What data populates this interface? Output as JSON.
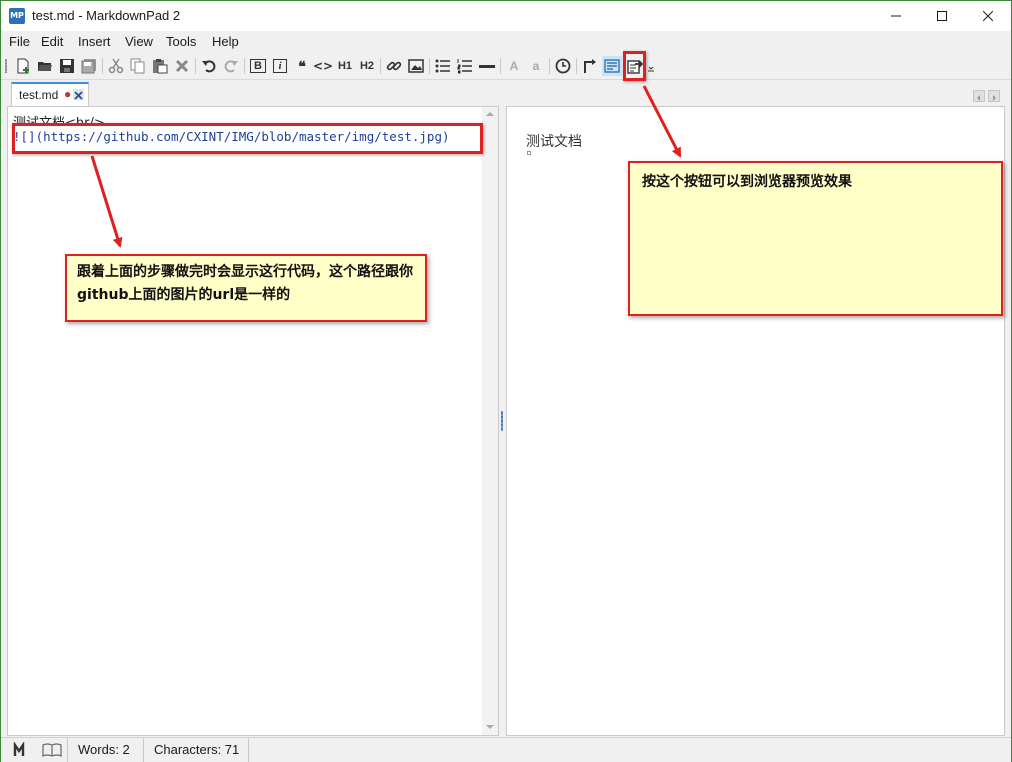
{
  "window": {
    "title": "test.md - MarkdownPad 2",
    "app_icon_text": "MP",
    "minimize_glyph": "—",
    "maximize_glyph": "☐",
    "close_glyph": "✕"
  },
  "menu": {
    "items": [
      "File",
      "Edit",
      "Insert",
      "View",
      "Tools",
      "Help"
    ]
  },
  "toolbar": {
    "h1_label": "H1",
    "h2_label": "H2",
    "bold_label": "B",
    "italic_label": "i",
    "quote_label": "❝",
    "code_label": "<>",
    "upper_a_label": "A",
    "lower_a_label": "a"
  },
  "tabs": {
    "active_label": "test.md",
    "modified_marker": "●",
    "close_glyph": "✕"
  },
  "editor": {
    "line1": "测试文档<hr/>",
    "line2_bang": "!",
    "line2_rest": "[](https://github.com/CXINT/IMG/blob/master/img/test.jpg)"
  },
  "preview": {
    "title": "测试文档"
  },
  "status": {
    "words": "Words: 2",
    "characters": "Characters: 71"
  },
  "annotations": {
    "editor_note": "跟着上面的步骤做完时会显示这行代码，这个路径跟你github上面的图片的url是一样的",
    "preview_note": "按这个按钮可以到浏览器预览效果"
  },
  "colors": {
    "annotation_red": "#e02020",
    "note_background": "#ffffc8",
    "tab_accent": "#3d8ee0",
    "link_blue": "#1f3f9a"
  }
}
